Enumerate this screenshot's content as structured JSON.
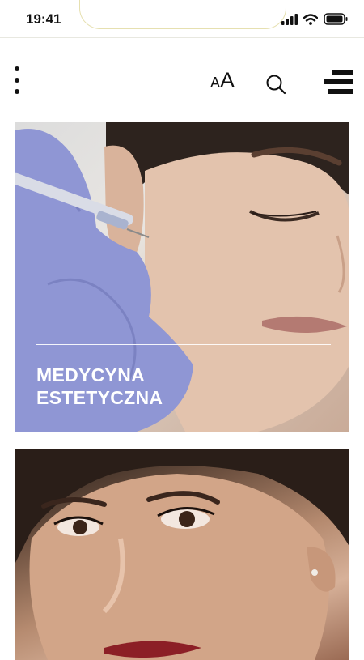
{
  "status_bar": {
    "time": "19:41",
    "icons": [
      "signal-icon",
      "wifi-icon",
      "battery-icon"
    ]
  },
  "header": {
    "more_icon": "vertical-dots-icon",
    "font_size_small": "A",
    "font_size_large": "A",
    "search_icon": "search-icon",
    "menu_icon": "menu-icon"
  },
  "cards": [
    {
      "title_line1": "MEDYCYNA",
      "title_line2": "ESTETYCZNA"
    }
  ],
  "colors": {
    "accent": "#111111",
    "background": "#ffffff",
    "glove": "#8f96d4"
  }
}
